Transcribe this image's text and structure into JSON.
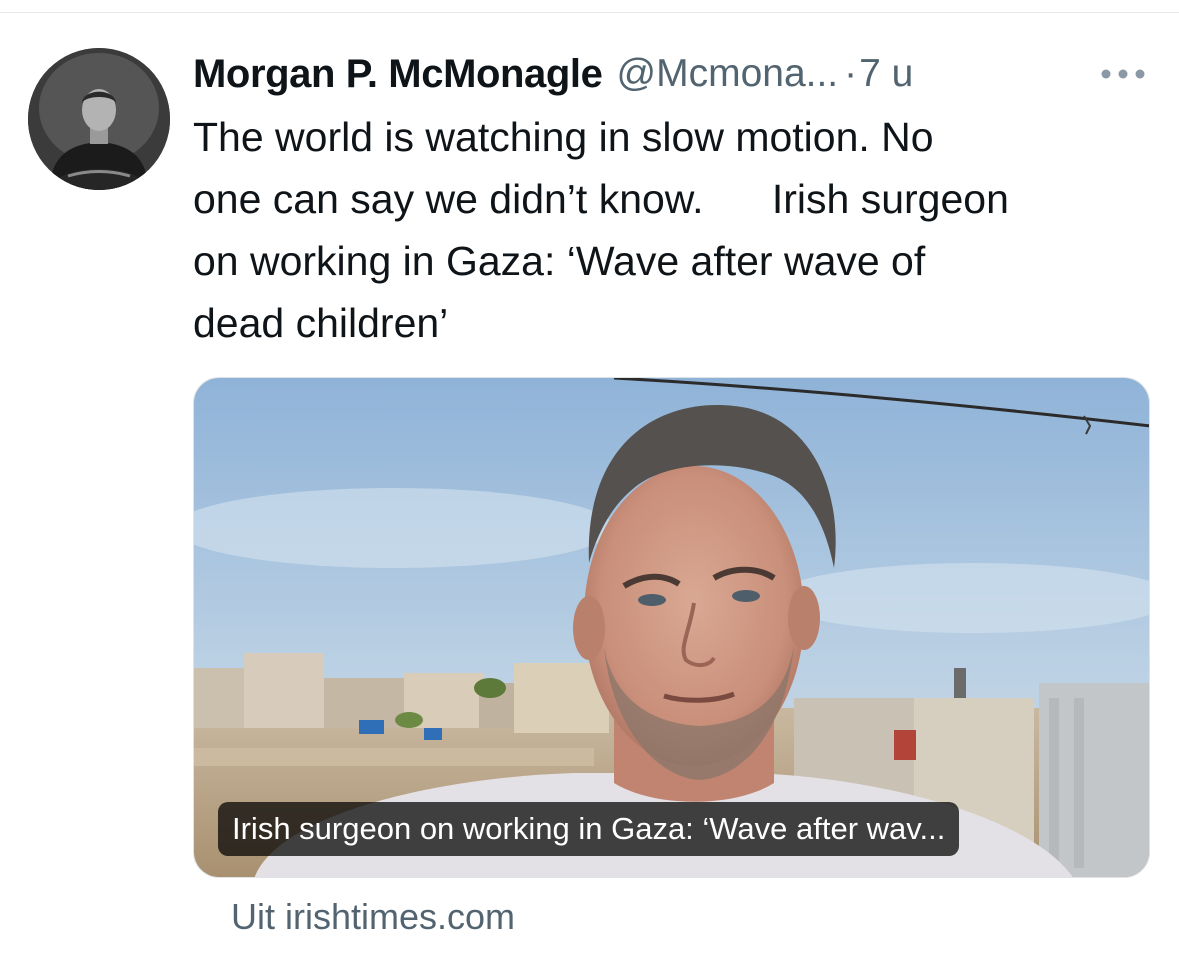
{
  "tweet": {
    "author_name": "Morgan P. McMonagle",
    "author_handle": "@Mcmona...",
    "separator": "·",
    "timestamp": "7 u",
    "text": "The world is watching in slow motion. No\none can say we didn’t know.      Irish surgeon\non working in Gaza: ‘Wave after wave of\ndead children’"
  },
  "card": {
    "caption": "Irish surgeon on working in Gaza: ‘Wave after wav...",
    "source": "Uit irishtimes.com"
  },
  "colors": {
    "text_primary": "#0f1419",
    "text_secondary": "#536471",
    "card_border": "#dfe3e6",
    "sky": "#a8c2dc"
  }
}
